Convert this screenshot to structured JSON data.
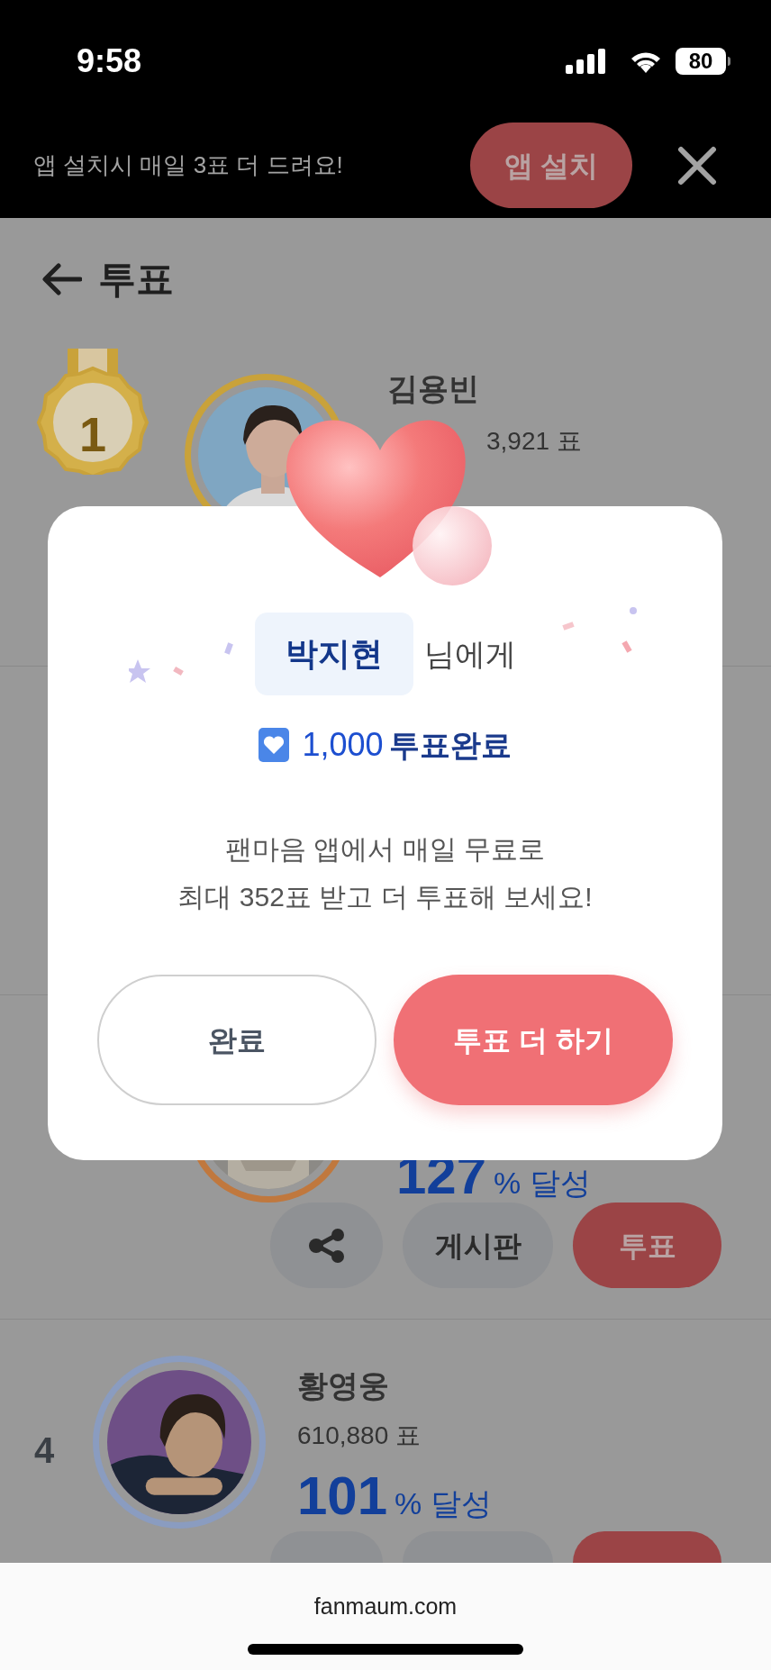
{
  "status_bar": {
    "time": "9:58",
    "battery": "80"
  },
  "banner": {
    "text": "앱 설치시 매일 3표 더 드려요!",
    "button": "앱 설치"
  },
  "header": {
    "title": "투표"
  },
  "row_1": {
    "rank": "1",
    "name": "김용빈",
    "votes": "3,921 표",
    "color": "#c9a23a"
  },
  "row_3": {
    "percent": "127",
    "suffix": "% 달성",
    "buttons": [
      "게시판",
      "투표"
    ],
    "color": "#c0783e"
  },
  "row_4": {
    "rank": "4",
    "name": "황영웅",
    "votes": "610,880 표",
    "percent": "101",
    "suffix": "% 달성",
    "color": "#8a9cc0"
  },
  "modal": {
    "recipient": "박지현",
    "recipient_suffix": "님에게",
    "vote_count": "1,000",
    "vote_label": "투표완료",
    "message": [
      "팬마음 앱에서 매일 무료로",
      "최대 352표 받고 더 투표해 보세요!"
    ],
    "buttons": [
      {
        "label": "완료",
        "kind": "secondary"
      },
      {
        "label": "투표 더 하기",
        "kind": "primary"
      }
    ]
  },
  "browser": {
    "url": "fanmaum.com"
  }
}
